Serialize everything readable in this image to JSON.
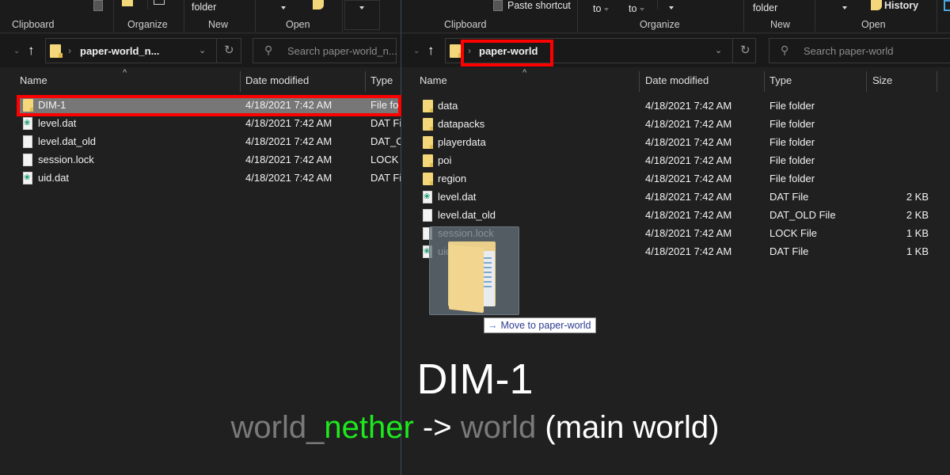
{
  "left_pane": {
    "ribbon": {
      "groups": [
        "Clipboard",
        "Organize",
        "New",
        "Open"
      ],
      "new_folder_label": "folder"
    },
    "address": {
      "path": "paper-world_n..."
    },
    "search": {
      "placeholder": "Search paper-world_n..."
    },
    "columns": [
      "Name",
      "Date modified",
      "Type"
    ],
    "rows": [
      {
        "icon": "folder",
        "name": "DIM-1",
        "date": "4/18/2021 7:42 AM",
        "type": "File fo",
        "selected": true
      },
      {
        "icon": "dat",
        "name": "level.dat",
        "date": "4/18/2021 7:42 AM",
        "type": "DAT Fil"
      },
      {
        "icon": "blank",
        "name": "level.dat_old",
        "date": "4/18/2021 7:42 AM",
        "type": "DAT_O"
      },
      {
        "icon": "blank",
        "name": "session.lock",
        "date": "4/18/2021 7:42 AM",
        "type": "LOCK I"
      },
      {
        "icon": "dat",
        "name": "uid.dat",
        "date": "4/18/2021 7:42 AM",
        "type": "DAT Fil"
      }
    ]
  },
  "right_pane": {
    "ribbon": {
      "paste_shortcut": "Paste shortcut",
      "move_to": "to",
      "copy_to": "to",
      "new_folder_label": "folder",
      "history": "History",
      "groups": [
        "Clipboard",
        "Organize",
        "New",
        "Open"
      ]
    },
    "address": {
      "path": "paper-world"
    },
    "search": {
      "placeholder": "Search paper-world"
    },
    "columns": [
      "Name",
      "Date modified",
      "Type",
      "Size"
    ],
    "rows": [
      {
        "icon": "folder",
        "name": "data",
        "date": "4/18/2021 7:42 AM",
        "type": "File folder",
        "size": ""
      },
      {
        "icon": "folder",
        "name": "datapacks",
        "date": "4/18/2021 7:42 AM",
        "type": "File folder",
        "size": ""
      },
      {
        "icon": "folder",
        "name": "playerdata",
        "date": "4/18/2021 7:42 AM",
        "type": "File folder",
        "size": ""
      },
      {
        "icon": "folder",
        "name": "poi",
        "date": "4/18/2021 7:42 AM",
        "type": "File folder",
        "size": ""
      },
      {
        "icon": "folder",
        "name": "region",
        "date": "4/18/2021 7:42 AM",
        "type": "File folder",
        "size": ""
      },
      {
        "icon": "dat",
        "name": "level.dat",
        "date": "4/18/2021 7:42 AM",
        "type": "DAT File",
        "size": "2 KB"
      },
      {
        "icon": "blank",
        "name": "level.dat_old",
        "date": "4/18/2021 7:42 AM",
        "type": "DAT_OLD File",
        "size": "2 KB"
      },
      {
        "icon": "blank",
        "name": "session.lock",
        "date": "4/18/2021 7:42 AM",
        "type": "LOCK File",
        "size": "1 KB"
      },
      {
        "icon": "dat",
        "name": "uid.dat",
        "date": "4/18/2021 7:42 AM",
        "type": "DAT File",
        "size": "1 KB"
      }
    ]
  },
  "drag": {
    "tooltip_arrow": "→",
    "tooltip_text": "Move to paper-world"
  },
  "caption": {
    "title": "DIM-1",
    "sub_world": "world_",
    "sub_nether": "nether",
    "sub_arrow": " -> ",
    "sub_target": "world",
    "sub_note": " (main world)"
  },
  "colors": {
    "highlight_red": "#ff0000",
    "nether_green": "#1ee81e",
    "background": "#202020"
  }
}
